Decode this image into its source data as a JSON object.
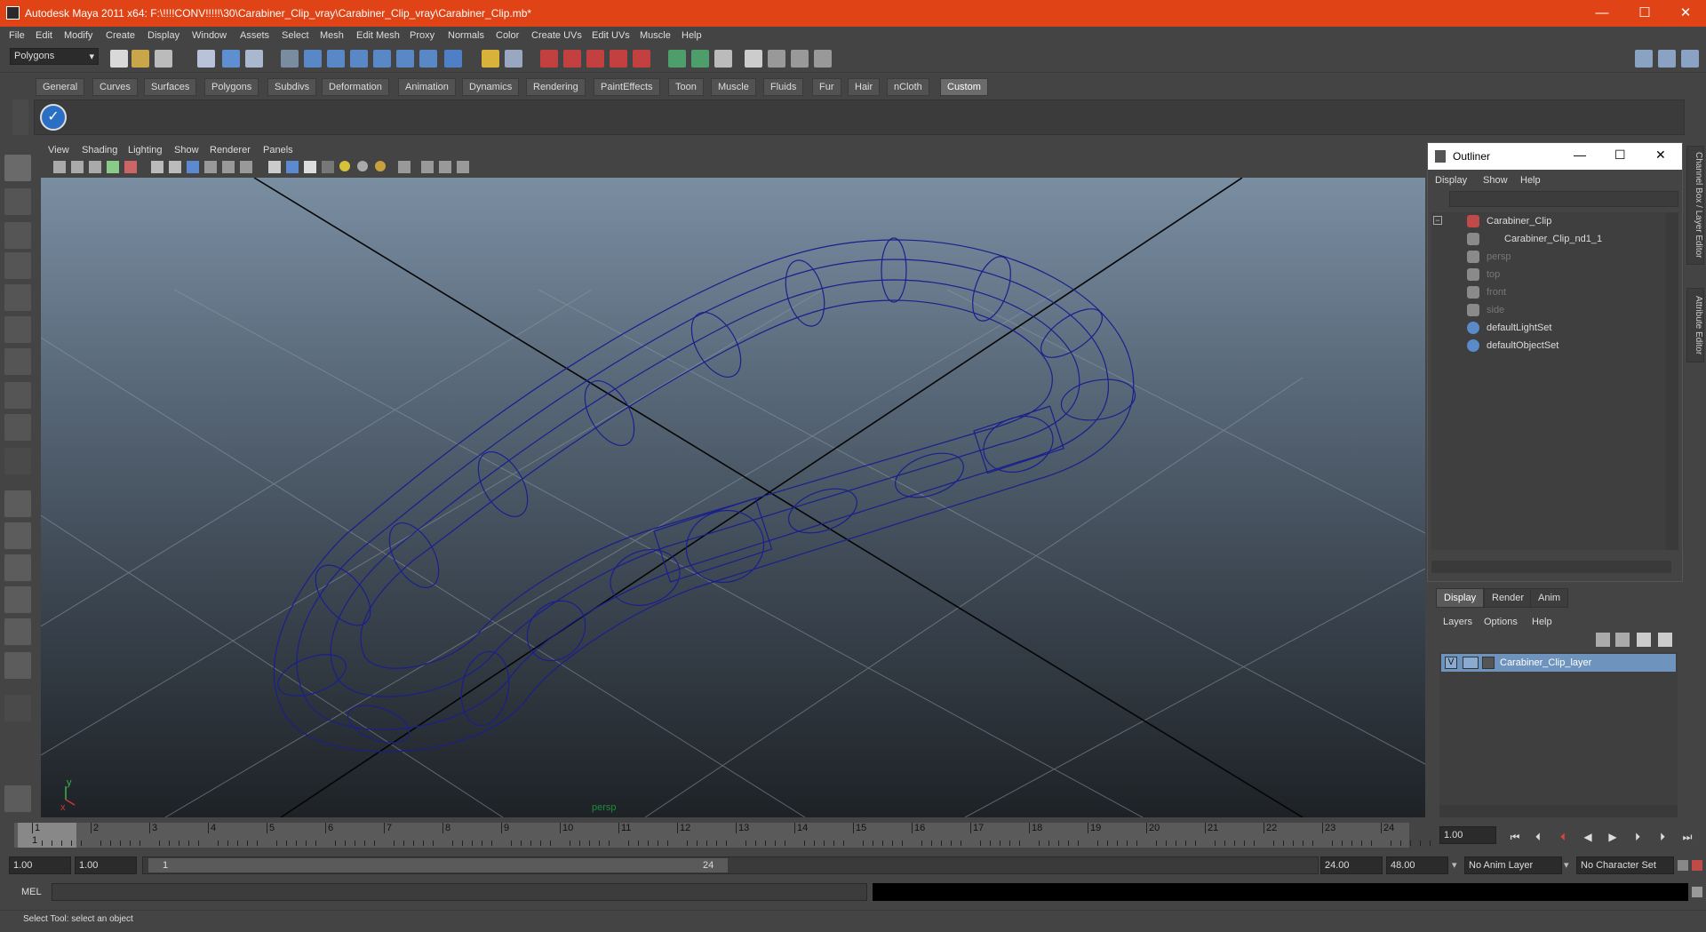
{
  "window": {
    "title": "Autodesk Maya 2011 x64: F:\\!!!!CONV!!!!!\\30\\Carabiner_Clip_vray\\Carabiner_Clip_vray\\Carabiner_Clip.mb*",
    "minimize": "—",
    "maximize": "☐",
    "close": "✕"
  },
  "menubar": [
    "File",
    "Edit",
    "Modify",
    "Create",
    "Display",
    "Window",
    "Assets",
    "Select",
    "Mesh",
    "Edit Mesh",
    "Proxy",
    "Normals",
    "Color",
    "Create UVs",
    "Edit UVs",
    "Muscle",
    "Help"
  ],
  "statusline": {
    "mode": "Polygons"
  },
  "shelf_tabs": [
    "General",
    "Curves",
    "Surfaces",
    "Polygons",
    "Subdivs",
    "Deformation",
    "Animation",
    "Dynamics",
    "Rendering",
    "PaintEffects",
    "Toon",
    "Muscle",
    "Fluids",
    "Fur",
    "Hair",
    "nCloth",
    "Custom"
  ],
  "shelf_active": "Custom",
  "viewport": {
    "menu": [
      "View",
      "Shading",
      "Lighting",
      "Show",
      "Renderer",
      "Panels"
    ],
    "camera_label": "persp",
    "axis_y": "y",
    "axis_x": "x"
  },
  "outliner": {
    "title": "Outliner",
    "menu": [
      "Display",
      "Show",
      "Help"
    ],
    "items": [
      {
        "label": "Carabiner_Clip",
        "icon": "transform-icon",
        "dim": false
      },
      {
        "label": "Carabiner_Clip_nd1_1",
        "icon": "mesh-icon",
        "dim": false
      },
      {
        "label": "persp",
        "icon": "camera-icon",
        "dim": true
      },
      {
        "label": "top",
        "icon": "camera-icon",
        "dim": true
      },
      {
        "label": "front",
        "icon": "camera-icon",
        "dim": true
      },
      {
        "label": "side",
        "icon": "camera-icon",
        "dim": true
      },
      {
        "label": "defaultLightSet",
        "icon": "set-icon",
        "dim": false
      },
      {
        "label": "defaultObjectSet",
        "icon": "set-icon",
        "dim": false
      }
    ]
  },
  "layer_editor": {
    "tabs": [
      "Display",
      "Render",
      "Anim"
    ],
    "menu": [
      "Layers",
      "Options",
      "Help"
    ],
    "layer": {
      "visible": "V",
      "name": "Carabiner_Clip_layer"
    }
  },
  "side_tabs": [
    "Channel Box / Layer Editor",
    "Attribute Editor"
  ],
  "timeline": {
    "ticks": [
      "1",
      "2",
      "3",
      "4",
      "5",
      "6",
      "7",
      "8",
      "9",
      "10",
      "11",
      "12",
      "13",
      "14",
      "15",
      "16",
      "17",
      "18",
      "19",
      "20",
      "21",
      "22",
      "23",
      "24"
    ],
    "current_frame": "1.00",
    "cursor_label": "1"
  },
  "range": {
    "start": "1.00",
    "anim_start": "1.00",
    "slider_start": "1",
    "slider_end": "24",
    "end": "24.00",
    "anim_end": "48.00",
    "anim_layer": "No Anim Layer",
    "char_set": "No Character Set"
  },
  "command": {
    "label": "MEL"
  },
  "helpline": "Select Tool: select an object",
  "colors": {
    "title_bar": "#e04316",
    "wireframe": "#1a1f8c",
    "layer_selected": "#6e93bd"
  }
}
